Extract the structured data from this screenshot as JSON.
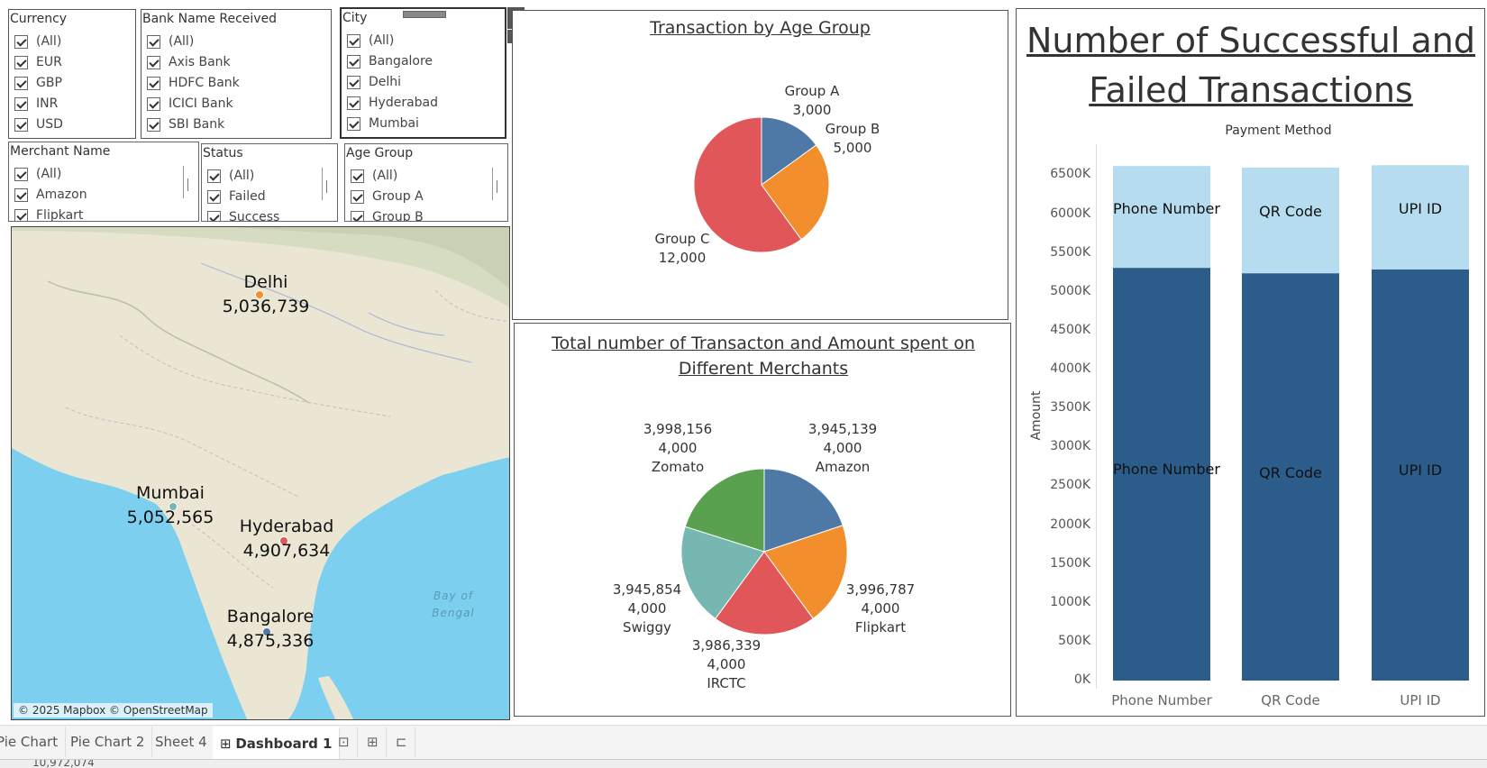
{
  "filters": {
    "currency": {
      "title": "Currency",
      "items": [
        "(All)",
        "EUR",
        "GBP",
        "INR",
        "USD"
      ]
    },
    "bank": {
      "title": "Bank Name Received",
      "items": [
        "(All)",
        "Axis Bank",
        "HDFC Bank",
        "ICICI Bank",
        "SBI Bank"
      ]
    },
    "city": {
      "title": "City",
      "items": [
        "(All)",
        "Bangalore",
        "Delhi",
        "Hyderabad",
        "Mumbai"
      ]
    },
    "merchant": {
      "title": "Merchant Name",
      "items": [
        "(All)",
        "Amazon",
        "Flipkart"
      ]
    },
    "status": {
      "title": "Status",
      "items": [
        "(All)",
        "Failed",
        "Success"
      ]
    },
    "age": {
      "title": "Age Group",
      "items": [
        "(All)",
        "Group A",
        "Group B"
      ]
    }
  },
  "map": {
    "attribution": "© 2025 Mapbox © OpenStreetMap",
    "bay_label": "Bay of Bengal",
    "cities": [
      {
        "name": "Delhi",
        "value": "5,036,739"
      },
      {
        "name": "Mumbai",
        "value": "5,052,565"
      },
      {
        "name": "Hyderabad",
        "value": "4,907,634"
      },
      {
        "name": "Bangalore",
        "value": "4,875,336"
      }
    ]
  },
  "age_pie": {
    "title": "Transaction by Age Group",
    "labels": [
      {
        "name": "Group A",
        "value": "3,000"
      },
      {
        "name": "Group B",
        "value": "5,000"
      },
      {
        "name": "Group C",
        "value": "12,000"
      }
    ]
  },
  "merchant_pie": {
    "title": "Total number of Transacton and Amount spent on Different Merchants",
    "labels": [
      {
        "amount": "3,945,139",
        "count": "4,000",
        "name": "Amazon"
      },
      {
        "amount": "3,996,787",
        "count": "4,000",
        "name": "Flipkart"
      },
      {
        "amount": "3,986,339",
        "count": "4,000",
        "name": "IRCTC"
      },
      {
        "amount": "3,945,854",
        "count": "4,000",
        "name": "Swiggy"
      },
      {
        "amount": "3,998,156",
        "count": "4,000",
        "name": "Zomato"
      }
    ]
  },
  "bar_chart": {
    "title": "Number of Successful and Failed Transactions",
    "header": "Payment Method",
    "ylabel": "Amount",
    "ticks": [
      "6500K",
      "6000K",
      "5500K",
      "5000K",
      "4500K",
      "4000K",
      "3500K",
      "3000K",
      "2500K",
      "2000K",
      "1500K",
      "1000K",
      "500K",
      "0K"
    ]
  },
  "tabs": [
    "Pie Chart",
    "Pie Chart 2",
    "Sheet 4",
    "Dashboard 1"
  ],
  "status_bar": "10,972,074",
  "chart_data": [
    {
      "type": "pie",
      "title": "Transaction by Age Group",
      "categories": [
        "Group A",
        "Group B",
        "Group C"
      ],
      "values": [
        3000,
        5000,
        12000
      ],
      "colors": [
        "#4e79a7",
        "#f28e2b",
        "#e15759"
      ]
    },
    {
      "type": "pie",
      "title": "Total number of Transacton and Amount spent on Different Merchants",
      "categories": [
        "Amazon",
        "Flipkart",
        "IRCTC",
        "Swiggy",
        "Zomato"
      ],
      "values": [
        3945139,
        3996787,
        3986339,
        3945854,
        3998156
      ],
      "counts": [
        4000,
        4000,
        4000,
        4000,
        4000
      ],
      "colors": [
        "#4e79a7",
        "#f28e2b",
        "#e15759",
        "#76b7b2",
        "#59a14f"
      ]
    },
    {
      "type": "bar",
      "stacked": true,
      "title": "Number of Successful and Failed Transactions",
      "xlabel": "Payment Method",
      "ylabel": "Amount",
      "categories": [
        "Phone Number",
        "QR Code",
        "UPI ID"
      ],
      "ylim": [
        0,
        6900000
      ],
      "series": [
        {
          "values": [
            5310000,
            5240000,
            5290000
          ],
          "color": "#2b5c8a"
        },
        {
          "values": [
            1310000,
            1360000,
            1340000
          ],
          "color": "#b5dcef"
        }
      ],
      "segment_labels": [
        "Phone Number",
        "QR Code",
        "UPI ID"
      ],
      "legend": "none"
    }
  ]
}
